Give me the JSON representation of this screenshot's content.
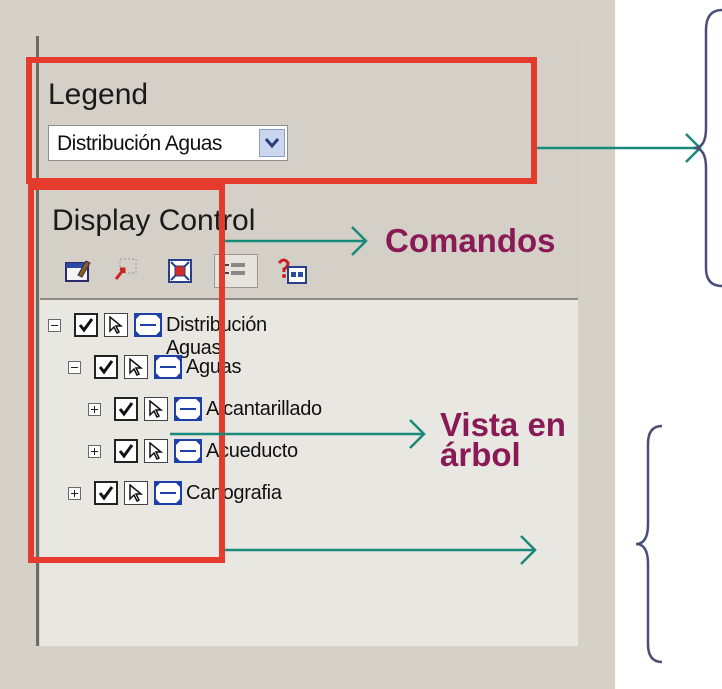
{
  "legend": {
    "title": "Legend",
    "selected_map": "Distribución Aguas"
  },
  "display_control": {
    "title": "Display Control",
    "toolbar": [
      {
        "icon": "map-properties-icon"
      },
      {
        "icon": "remove-layer-icon"
      },
      {
        "icon": "zoom-to-layer-icon"
      },
      {
        "icon": "legend-toggle-icon"
      },
      {
        "icon": "layer-help-icon"
      }
    ]
  },
  "tree": [
    {
      "label": "Distribución Aguas",
      "expander": "minus",
      "level": 0
    },
    {
      "label": "Aguas",
      "expander": "minus",
      "level": 1
    },
    {
      "label": "Alcantarillado",
      "expander": "plus",
      "level": 2
    },
    {
      "label": "Acueducto",
      "expander": "plus",
      "level": 2
    },
    {
      "label": "Cartografia",
      "expander": "plus",
      "level": 1
    }
  ],
  "annotations": {
    "commands_label": "Comandos",
    "tree_view_label_line1": "Vista en",
    "tree_view_label_line2": "árbol"
  },
  "colors": {
    "highlight_box": "#e53b2c",
    "arrow": "#1a8a78",
    "annotation_text": "#8a1a55",
    "brace": "#4a4f7a",
    "panel": "#d4d0c8"
  }
}
